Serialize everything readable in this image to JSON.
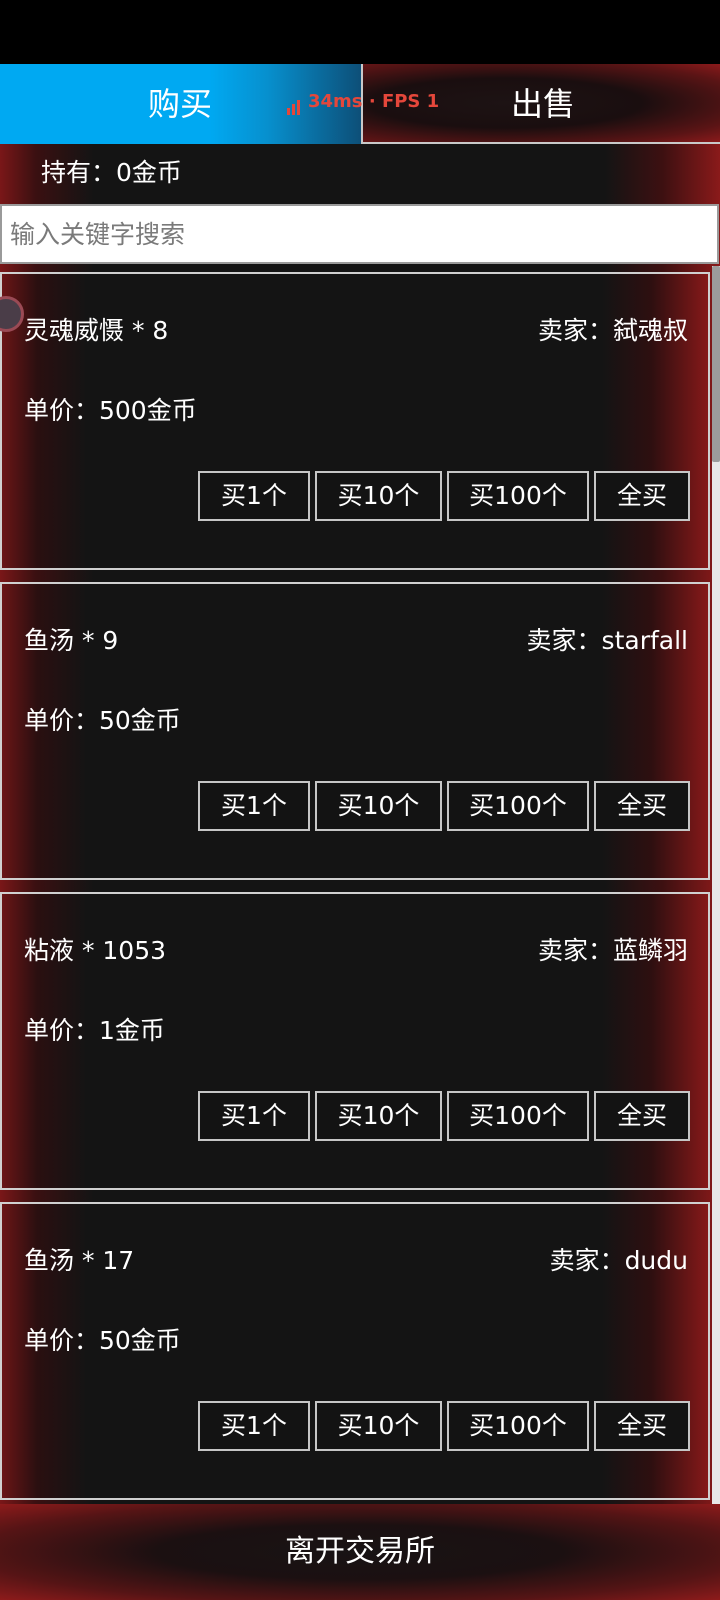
{
  "tabs": {
    "buy": "购买",
    "sell": "出售"
  },
  "perf": {
    "ping": "34ms",
    "separator": "·",
    "fps": "FPS 1"
  },
  "holding": "持有：0金币",
  "search": {
    "placeholder": "输入关键字搜索",
    "value": ""
  },
  "buttons": {
    "buy1": "买1个",
    "buy10": "买10个",
    "buy100": "买100个",
    "buyAll": "全买"
  },
  "listings": [
    {
      "item": "灵魂威慑 * 8",
      "seller": "卖家：弑魂叔",
      "price": "单价：500金币"
    },
    {
      "item": "鱼汤 * 9",
      "seller": "卖家：starfall",
      "price": "单价：50金币"
    },
    {
      "item": "粘液 * 1053",
      "seller": "卖家：蓝鳞羽",
      "price": "单价：1金币"
    },
    {
      "item": "鱼汤 * 17",
      "seller": "卖家：dudu",
      "price": "单价：50金币"
    }
  ],
  "leave": "离开交易所",
  "colors": {
    "buy_tab": "#00a9f2",
    "accent_red": "#8a1a1a",
    "panel": "#141414",
    "perf": "#e5473b"
  }
}
